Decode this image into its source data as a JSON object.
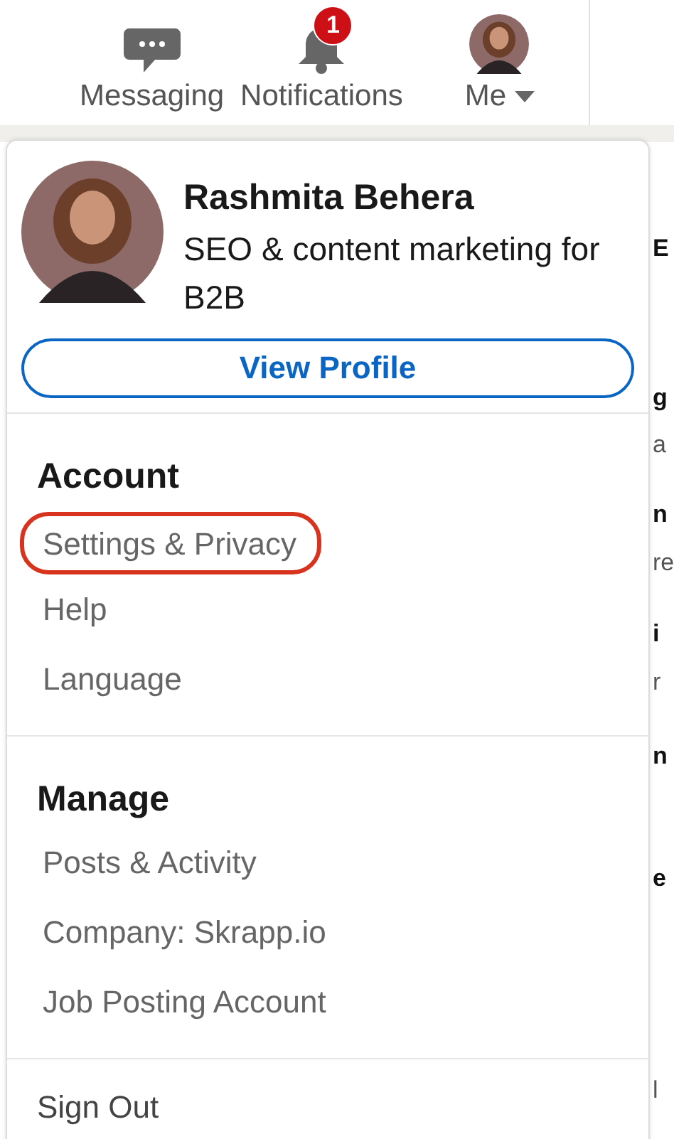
{
  "nav": [
    {
      "kind": "messaging",
      "label": "Messaging"
    },
    {
      "kind": "notifications",
      "label": "Notifications",
      "badge": "1"
    },
    {
      "kind": "me",
      "label": "Me"
    }
  ],
  "profile": {
    "name": "Rashmita Behera",
    "headline": "SEO & content marketing for B2B",
    "button": "View Profile"
  },
  "sections": [
    {
      "heading": "Account",
      "items": [
        {
          "label": "Settings & Privacy",
          "highlighted": true
        },
        {
          "label": "Help",
          "highlighted": false
        },
        {
          "label": "Language",
          "highlighted": false
        }
      ]
    },
    {
      "heading": "Manage",
      "items": [
        {
          "label": "Posts & Activity",
          "highlighted": false
        },
        {
          "label": "Company: Skrapp.io",
          "highlighted": false
        },
        {
          "label": "Job Posting Account",
          "highlighted": false
        }
      ]
    }
  ],
  "sign_out": "Sign Out",
  "background_fragments": [
    {
      "text": "E",
      "bold": true
    },
    {
      "text": "g",
      "bold": true
    },
    {
      "text": "a",
      "bold": false
    },
    {
      "text": "n",
      "bold": true
    },
    {
      "text": "re",
      "bold": false
    },
    {
      "text": "i",
      "bold": true
    },
    {
      "text": "r",
      "bold": false
    },
    {
      "text": "n",
      "bold": true
    },
    {
      "text": "e",
      "bold": true
    },
    {
      "text": "l",
      "bold": false
    }
  ]
}
